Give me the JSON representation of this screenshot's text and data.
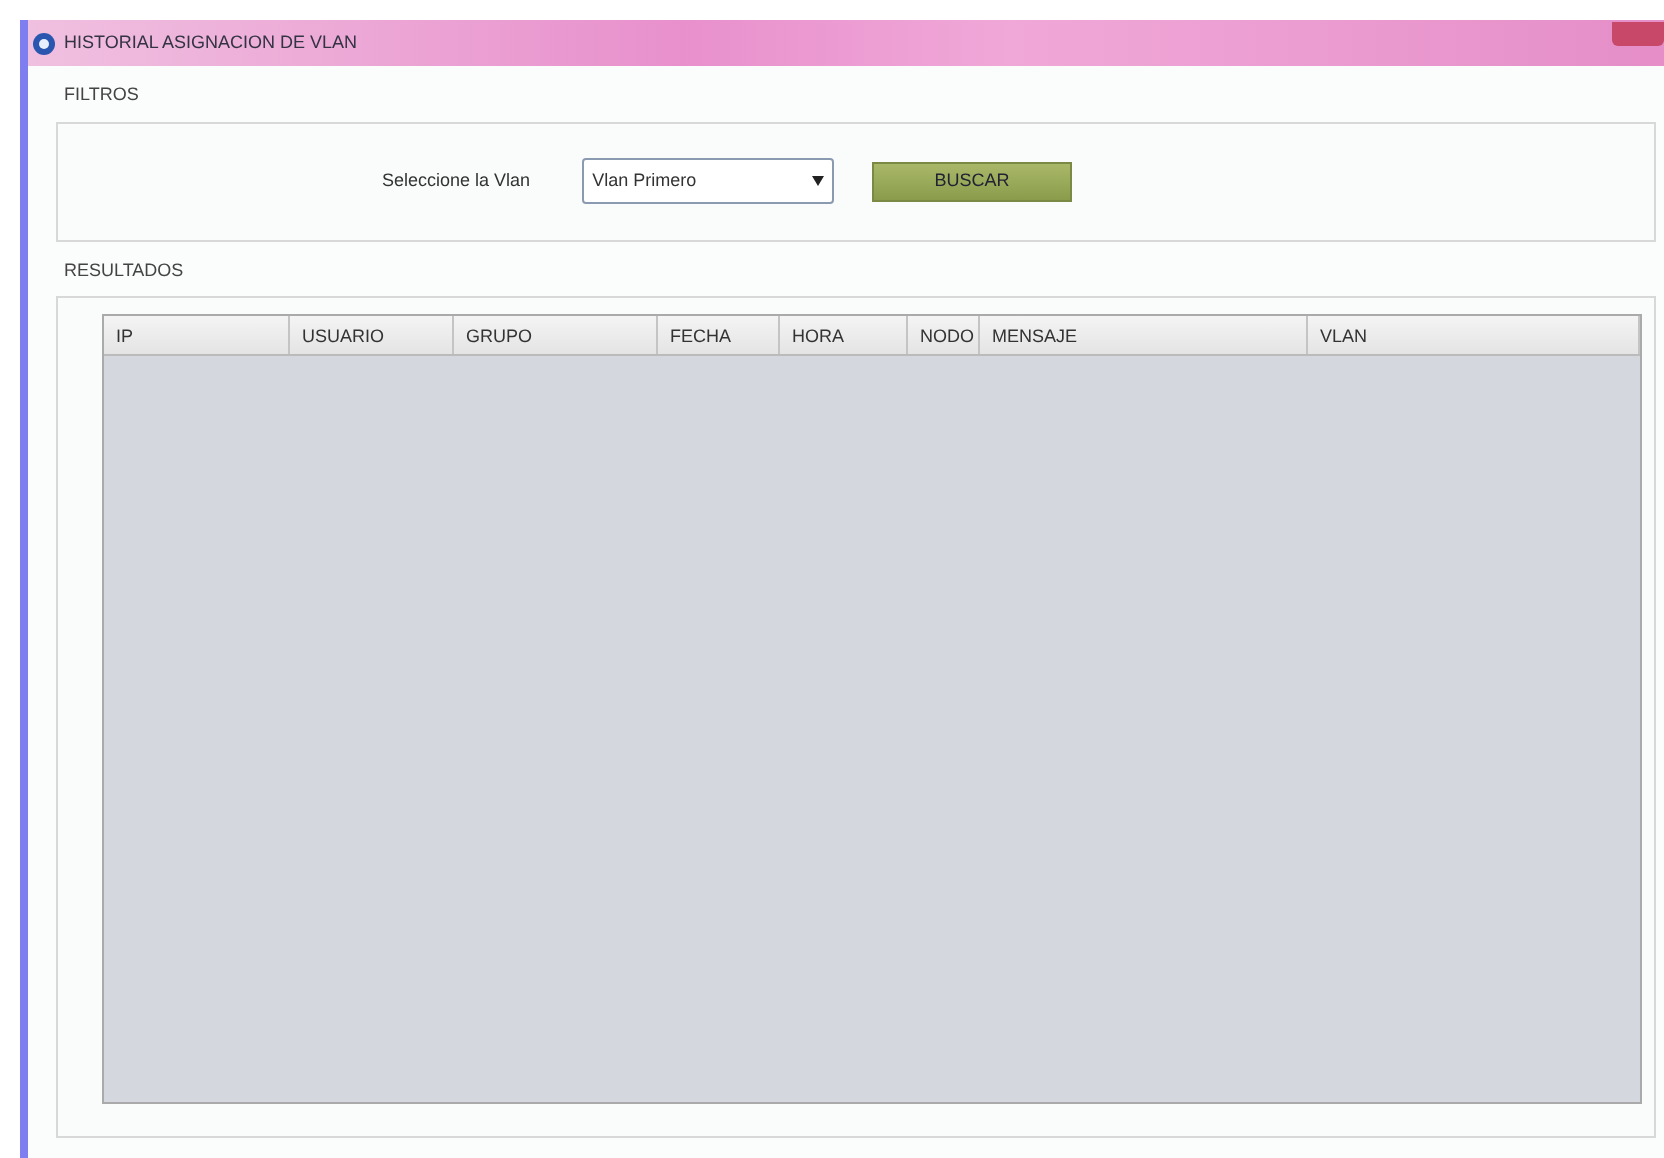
{
  "window": {
    "title": "HISTORIAL ASIGNACION DE VLAN"
  },
  "filters": {
    "title": "FILTROS",
    "label": "Seleccione la Vlan",
    "select": {
      "value": "Vlan Primero"
    },
    "button": "BUSCAR"
  },
  "results": {
    "title": "RESULTADOS",
    "table": {
      "columns": [
        "IP",
        "USUARIO",
        "GRUPO",
        "FECHA",
        "HORA",
        "NODO",
        "MENSAJE",
        "VLAN"
      ]
    }
  }
}
